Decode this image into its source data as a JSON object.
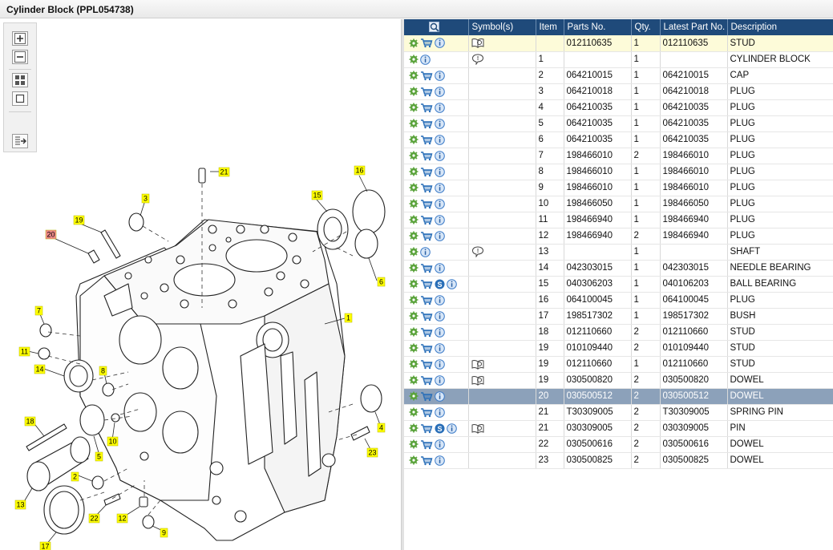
{
  "window": {
    "title": "Cylinder Block (PPL054738)"
  },
  "toolbar": {
    "buttons": [
      {
        "name": "zoom-in-button",
        "icon": "zoom-in-icon"
      },
      {
        "name": "zoom-out-button",
        "icon": "zoom-out-icon"
      },
      {
        "name": "fit-view-button",
        "icon": "fit-view-icon"
      },
      {
        "name": "actual-size-button",
        "icon": "actual-size-icon"
      },
      {
        "name": "sync-list-button",
        "icon": "sync-list-icon"
      }
    ]
  },
  "callouts": [
    "21",
    "16",
    "3",
    "15",
    "19",
    "20",
    "6",
    "7",
    "1",
    "11",
    "14",
    "8",
    "18",
    "4",
    "5",
    "10",
    "23",
    "2",
    "13",
    "22",
    "12",
    "9",
    "17"
  ],
  "table": {
    "headers": [
      "",
      "Symbol(s)",
      "Item",
      "Parts No.",
      "Qty.",
      "Latest Part No.",
      "Description"
    ],
    "colors": {
      "header_bg": "#1f4a7a",
      "highlight_row": "#fdfbd9",
      "selected_row": "#8ca1ba",
      "callout_yellow": "#ffff00",
      "callout_red": "#f08a8a"
    },
    "rows": [
      {
        "icons": [
          "gear",
          "cart",
          "info"
        ],
        "symbol": "book",
        "item": "",
        "parts_no": "012110635",
        "qty": "1",
        "latest": "012110635",
        "desc": "STUD",
        "state": "highlight"
      },
      {
        "icons": [
          "gear",
          "info"
        ],
        "symbol": "note",
        "item": "1",
        "parts_no": "",
        "qty": "1",
        "latest": "",
        "desc": "CYLINDER BLOCK",
        "state": ""
      },
      {
        "icons": [
          "gear",
          "cart",
          "info"
        ],
        "symbol": "",
        "item": "2",
        "parts_no": "064210015",
        "qty": "1",
        "latest": "064210015",
        "desc": "CAP",
        "state": ""
      },
      {
        "icons": [
          "gear",
          "cart",
          "info"
        ],
        "symbol": "",
        "item": "3",
        "parts_no": "064210018",
        "qty": "1",
        "latest": "064210018",
        "desc": "PLUG",
        "state": ""
      },
      {
        "icons": [
          "gear",
          "cart",
          "info"
        ],
        "symbol": "",
        "item": "4",
        "parts_no": "064210035",
        "qty": "1",
        "latest": "064210035",
        "desc": "PLUG",
        "state": ""
      },
      {
        "icons": [
          "gear",
          "cart",
          "info"
        ],
        "symbol": "",
        "item": "5",
        "parts_no": "064210035",
        "qty": "1",
        "latest": "064210035",
        "desc": "PLUG",
        "state": ""
      },
      {
        "icons": [
          "gear",
          "cart",
          "info"
        ],
        "symbol": "",
        "item": "6",
        "parts_no": "064210035",
        "qty": "1",
        "latest": "064210035",
        "desc": "PLUG",
        "state": ""
      },
      {
        "icons": [
          "gear",
          "cart",
          "info"
        ],
        "symbol": "",
        "item": "7",
        "parts_no": "198466010",
        "qty": "2",
        "latest": "198466010",
        "desc": "PLUG",
        "state": ""
      },
      {
        "icons": [
          "gear",
          "cart",
          "info"
        ],
        "symbol": "",
        "item": "8",
        "parts_no": "198466010",
        "qty": "1",
        "latest": "198466010",
        "desc": "PLUG",
        "state": ""
      },
      {
        "icons": [
          "gear",
          "cart",
          "info"
        ],
        "symbol": "",
        "item": "9",
        "parts_no": "198466010",
        "qty": "1",
        "latest": "198466010",
        "desc": "PLUG",
        "state": ""
      },
      {
        "icons": [
          "gear",
          "cart",
          "info"
        ],
        "symbol": "",
        "item": "10",
        "parts_no": "198466050",
        "qty": "1",
        "latest": "198466050",
        "desc": "PLUG",
        "state": ""
      },
      {
        "icons": [
          "gear",
          "cart",
          "info"
        ],
        "symbol": "",
        "item": "11",
        "parts_no": "198466940",
        "qty": "1",
        "latest": "198466940",
        "desc": "PLUG",
        "state": ""
      },
      {
        "icons": [
          "gear",
          "cart",
          "info"
        ],
        "symbol": "",
        "item": "12",
        "parts_no": "198466940",
        "qty": "2",
        "latest": "198466940",
        "desc": "PLUG",
        "state": ""
      },
      {
        "icons": [
          "gear",
          "info"
        ],
        "symbol": "note",
        "item": "13",
        "parts_no": "",
        "qty": "1",
        "latest": "",
        "desc": "SHAFT",
        "state": ""
      },
      {
        "icons": [
          "gear",
          "cart",
          "info"
        ],
        "symbol": "",
        "item": "14",
        "parts_no": "042303015",
        "qty": "1",
        "latest": "042303015",
        "desc": "NEEDLE BEARING",
        "state": ""
      },
      {
        "icons": [
          "gear",
          "cart",
          "s",
          "info"
        ],
        "symbol": "",
        "item": "15",
        "parts_no": "040306203",
        "qty": "1",
        "latest": "040106203",
        "desc": "BALL BEARING",
        "state": ""
      },
      {
        "icons": [
          "gear",
          "cart",
          "info"
        ],
        "symbol": "",
        "item": "16",
        "parts_no": "064100045",
        "qty": "1",
        "latest": "064100045",
        "desc": "PLUG",
        "state": ""
      },
      {
        "icons": [
          "gear",
          "cart",
          "info"
        ],
        "symbol": "",
        "item": "17",
        "parts_no": "198517302",
        "qty": "1",
        "latest": "198517302",
        "desc": "BUSH",
        "state": ""
      },
      {
        "icons": [
          "gear",
          "cart",
          "info"
        ],
        "symbol": "",
        "item": "18",
        "parts_no": "012110660",
        "qty": "2",
        "latest": "012110660",
        "desc": "STUD",
        "state": ""
      },
      {
        "icons": [
          "gear",
          "cart",
          "info"
        ],
        "symbol": "",
        "item": "19",
        "parts_no": "010109440",
        "qty": "2",
        "latest": "010109440",
        "desc": "STUD",
        "state": ""
      },
      {
        "icons": [
          "gear",
          "cart",
          "info"
        ],
        "symbol": "book",
        "item": "19",
        "parts_no": "012110660",
        "qty": "1",
        "latest": "012110660",
        "desc": "STUD",
        "state": ""
      },
      {
        "icons": [
          "gear",
          "cart",
          "info"
        ],
        "symbol": "book",
        "item": "19",
        "parts_no": "030500820",
        "qty": "2",
        "latest": "030500820",
        "desc": "DOWEL",
        "state": ""
      },
      {
        "icons": [
          "gear",
          "cart",
          "info"
        ],
        "symbol": "",
        "item": "20",
        "parts_no": "030500512",
        "qty": "2",
        "latest": "030500512",
        "desc": "DOWEL",
        "state": "selected"
      },
      {
        "icons": [
          "gear",
          "cart",
          "info"
        ],
        "symbol": "",
        "item": "21",
        "parts_no": "T30309005",
        "qty": "2",
        "latest": "T30309005",
        "desc": "SPRING PIN",
        "state": ""
      },
      {
        "icons": [
          "gear",
          "cart",
          "s",
          "info"
        ],
        "symbol": "book",
        "item": "21",
        "parts_no": "030309005",
        "qty": "2",
        "latest": "030309005",
        "desc": "PIN",
        "state": ""
      },
      {
        "icons": [
          "gear",
          "cart",
          "info"
        ],
        "symbol": "",
        "item": "22",
        "parts_no": "030500616",
        "qty": "2",
        "latest": "030500616",
        "desc": "DOWEL",
        "state": ""
      },
      {
        "icons": [
          "gear",
          "cart",
          "info"
        ],
        "symbol": "",
        "item": "23",
        "parts_no": "030500825",
        "qty": "2",
        "latest": "030500825",
        "desc": "DOWEL",
        "state": ""
      }
    ]
  }
}
